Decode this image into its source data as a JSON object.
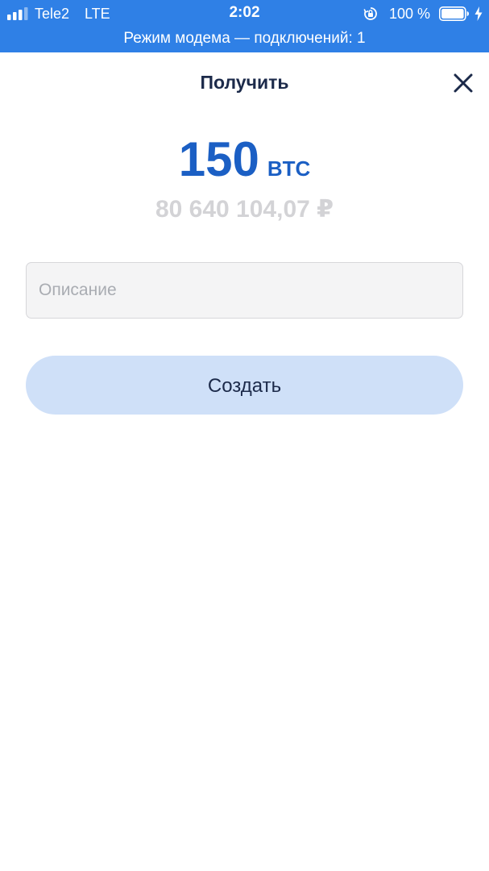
{
  "status_bar": {
    "carrier": "Tele2",
    "network": "LTE",
    "time": "2:02",
    "battery": "100 %",
    "hotspot_banner": "Режим модема — подключений: 1",
    "icons": {
      "signal": "signal-bars-icon",
      "rotation_lock": "rotation-lock-icon",
      "battery": "battery-icon",
      "charging": "charging-bolt-icon"
    },
    "bar_color": "#2f80e6"
  },
  "header": {
    "title": "Получить",
    "close_icon": "close-icon"
  },
  "amount": {
    "value": "150",
    "unit": "BTC",
    "fiat": "80 640 104,07 ₽"
  },
  "description": {
    "value": "",
    "placeholder": "Описание"
  },
  "actions": {
    "create_label": "Создать"
  },
  "colors": {
    "accent": "#1b5fc4",
    "button_bg": "#cfe0f8",
    "title_text": "#1c2a4a",
    "fiat_text": "#d3d3d6"
  }
}
